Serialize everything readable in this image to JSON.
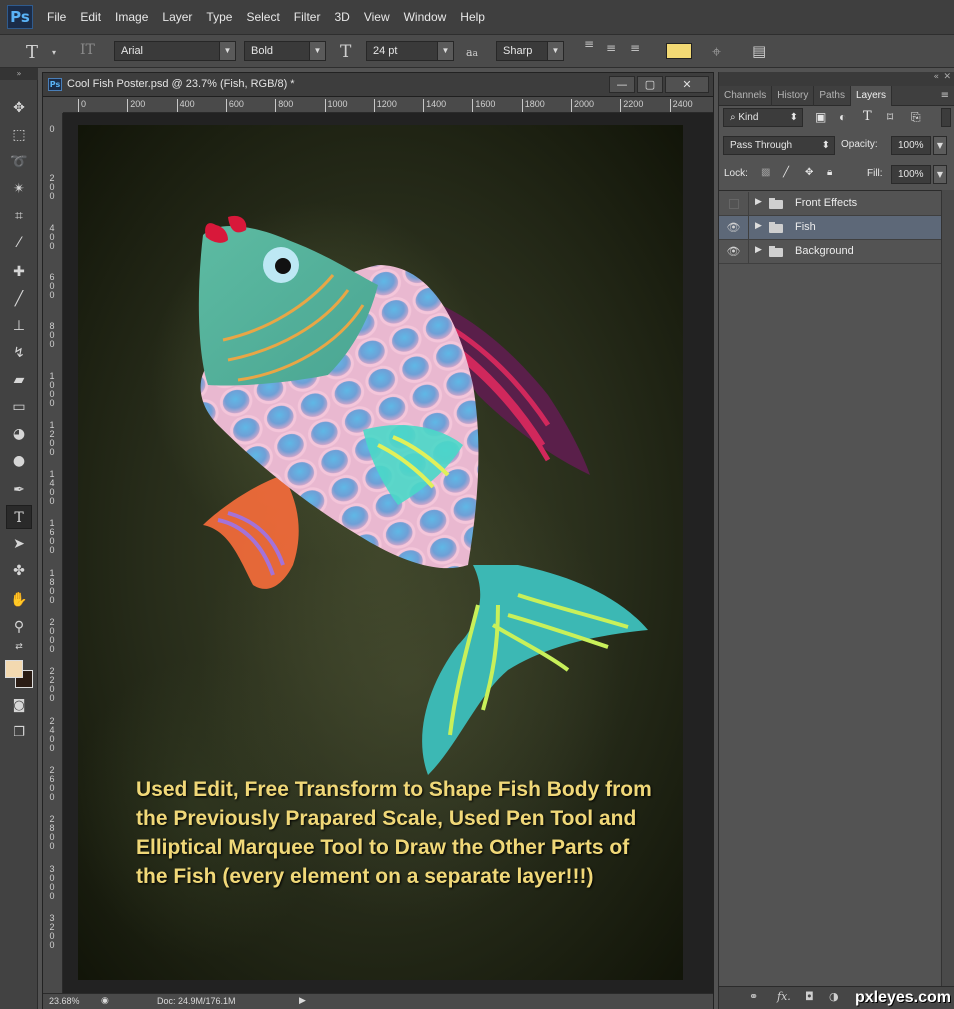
{
  "app": {
    "logo": "Ps"
  },
  "menu": [
    "File",
    "Edit",
    "Image",
    "Layer",
    "Type",
    "Select",
    "Filter",
    "3D",
    "View",
    "Window",
    "Help"
  ],
  "options": {
    "font_family": "Arial",
    "font_style": "Bold",
    "font_size": "24 pt",
    "aa_label": "a",
    "aa_mode": "Sharp",
    "text_color": "#f2d974"
  },
  "document": {
    "title": "Cool Fish Poster.psd @ 23.7% (Fish, RGB/8) *",
    "icon": "Ps",
    "ruler_h": [
      "0",
      "200",
      "400",
      "600",
      "800",
      "1000",
      "1200",
      "1400",
      "1600",
      "1800",
      "2000",
      "2200",
      "2400"
    ],
    "ruler_v": [
      "0",
      "2 0 0",
      "4 0 0",
      "6 0 0",
      "8 0 0",
      "1 0 0 0",
      "1 2 0 0",
      "1 4 0 0",
      "1 6 0 0",
      "1 8 0 0",
      "2 0 0 0",
      "2 2 0 0",
      "2 4 0 0",
      "2 6 0 0",
      "2 8 0 0",
      "3 0 0 0",
      "3 2 0 0"
    ],
    "caption": "Used Edit, Free Transform to Shape Fish Body from the Previously Prapared Scale, Used Pen Tool and Elliptical Marquee Tool to Draw the Other Parts of the Fish (every element on a separate layer!!!)",
    "zoom": "23.68%",
    "doc_size": "Doc: 24.9M/176.1M"
  },
  "panel": {
    "tabs": [
      "Channels",
      "History",
      "Paths",
      "Layers"
    ],
    "active_tab": "Layers",
    "filter_kind": "Kind",
    "blend_mode": "Pass Through",
    "opacity_label": "Opacity:",
    "opacity_value": "100%",
    "lock_label": "Lock:",
    "fill_label": "Fill:",
    "fill_value": "100%",
    "layers": [
      {
        "name": "Front Effects",
        "visible": false
      },
      {
        "name": "Fish",
        "visible": true,
        "selected": true
      },
      {
        "name": "Background",
        "visible": true
      }
    ],
    "bottom_icons": [
      "link-icon",
      "fx-icon",
      "mask-icon",
      "adjustment-icon"
    ]
  },
  "watermark": "pxleyes.com",
  "colors": {
    "foreground": "#f3d9b0",
    "background": "#2a1c14",
    "selected_layer": "#5d6878"
  }
}
